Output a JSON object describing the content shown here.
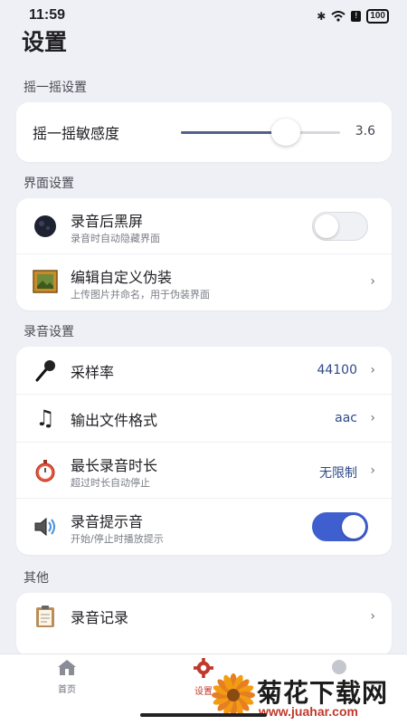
{
  "status_bar": {
    "time": "11:59",
    "battery": "100"
  },
  "page": {
    "title": "设置"
  },
  "sections": {
    "shake": {
      "label": "摇一摇设置",
      "sensitivity_label": "摇一摇敏感度",
      "sensitivity_value": "3.6",
      "slider_fraction": 0.66
    },
    "ui": {
      "label": "界面设置",
      "black_screen": {
        "title": "录音后黑屏",
        "subtitle": "录音时自动隐藏界面",
        "enabled": false
      },
      "disguise": {
        "title": "编辑自定义伪装",
        "subtitle": "上传图片并命名，用于伪装界面"
      }
    },
    "recording": {
      "label": "录音设置",
      "sample_rate": {
        "title": "采样率",
        "value": "44100"
      },
      "format": {
        "title": "输出文件格式",
        "value": "aac"
      },
      "max_duration": {
        "title": "最长录音时长",
        "subtitle": "超过时长自动停止",
        "value": "无限制"
      },
      "beep": {
        "title": "录音提示音",
        "subtitle": "开始/停止时播放提示",
        "enabled": true
      }
    },
    "other": {
      "label": "其他",
      "history": {
        "title": "录音记录"
      }
    }
  },
  "bottom_nav": {
    "home": "首页",
    "settings": "设置"
  },
  "watermark": {
    "brand": "菊花下载网",
    "url": "www.juahar.com"
  },
  "colors": {
    "accent": "#3f5fcf",
    "active_nav": "#c0392b",
    "background": "#eef0f5"
  }
}
